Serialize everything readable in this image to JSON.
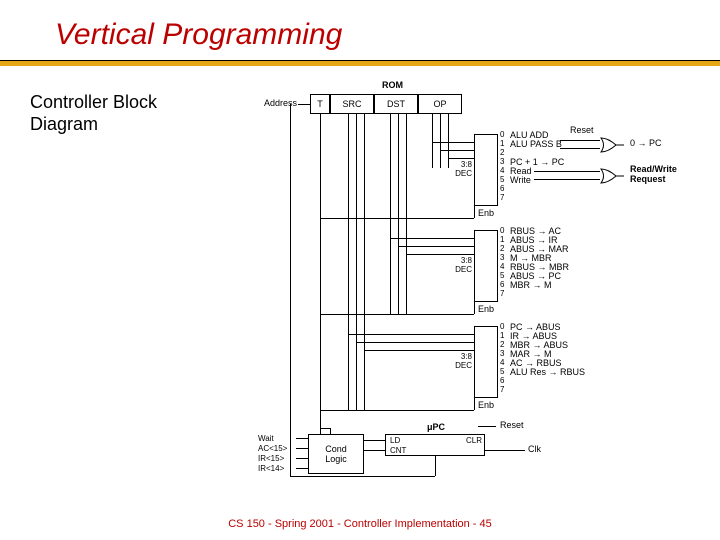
{
  "title": "Vertical Programming",
  "subtitle": "Controller Block\nDiagram",
  "footer": "CS 150 - Spring 2001 - Controller Implementation - 45",
  "rom": {
    "label": "ROM",
    "addr_label": "Address",
    "fields": [
      "T",
      "SRC",
      "DST",
      "OP"
    ]
  },
  "reset": "Reset",
  "clk": "Clk",
  "gate_out1": "0 → PC",
  "gate_out2_a": "Read/Write",
  "gate_out2_b": "Request",
  "dec_label": "3:8\nDEC",
  "enb": "Enb",
  "dec1": {
    "outs": [
      "ALU ADD",
      "ALU PASS B",
      "",
      "PC + 1 → PC",
      "Read",
      "Write",
      "",
      ""
    ]
  },
  "dec2": {
    "outs": [
      "RBUS  → AC",
      "ABUS → IR",
      "ABUS → MAR",
      "M  → MBR",
      "RBUS → MBR",
      "ABUS → PC",
      "MBR  → M",
      ""
    ]
  },
  "dec3": {
    "outs": [
      "PC → ABUS",
      "IR → ABUS",
      "MBR → ABUS",
      "MAR → M",
      "AC  → RBUS",
      "ALU Res → RBUS",
      "",
      ""
    ]
  },
  "upc": {
    "label": "μPC",
    "ld": "LD",
    "cnt": "CNT",
    "clr": "CLR"
  },
  "cond": {
    "label": "Cond\nLogic",
    "inputs": [
      "Wait",
      "AC<15>",
      "IR<15>",
      "IR<14>"
    ]
  }
}
